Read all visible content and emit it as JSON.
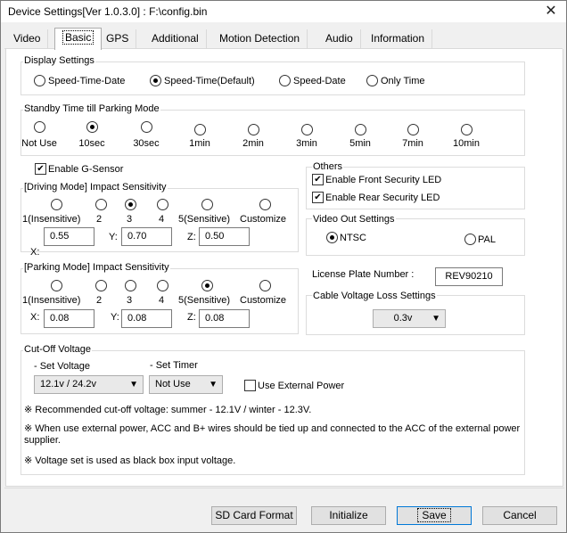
{
  "window": {
    "title": "Device Settings[Ver 1.0.3.0] : F:\\config.bin",
    "close": "✕"
  },
  "tabs": [
    "Video",
    "Basic",
    "GPS",
    "Additional",
    "Motion Detection",
    "Audio",
    "Information"
  ],
  "display": {
    "title": "Display Settings",
    "options": [
      "Speed-Time-Date",
      "Speed-Time(Default)",
      "Speed-Date",
      "Only Time"
    ],
    "selected": "Speed-Time(Default)"
  },
  "standby": {
    "title": "Standby Time till Parking Mode",
    "options": [
      "Not Use",
      "10sec",
      "30sec",
      "1min",
      "2min",
      "3min",
      "5min",
      "7min",
      "10min"
    ],
    "selected": "10sec"
  },
  "gsensor": {
    "label": "Enable G-Sensor",
    "checked": true
  },
  "driving": {
    "title": "[Driving Mode] Impact Sensitivity",
    "levels": [
      "1(Insensitive)",
      "2",
      "3",
      "4",
      "5(Sensitive)",
      "Customize"
    ],
    "selected": "3",
    "x_label": "X:",
    "x": "0.55",
    "y_label": "Y:",
    "y": "0.70",
    "z_label": "Z:",
    "z": "0.50"
  },
  "parking": {
    "title": "[Parking Mode] Impact Sensitivity",
    "levels": [
      "1(Insensitive)",
      "2",
      "3",
      "4",
      "5(Sensitive)",
      "Customize"
    ],
    "selected": "5(Sensitive)",
    "x_label": "X:",
    "x": "0.08",
    "y_label": "Y:",
    "y": "0.08",
    "z_label": "Z:",
    "z": "0.08"
  },
  "others": {
    "title": "Others",
    "front_led": "Enable Front Security LED",
    "front_checked": true,
    "rear_led": "Enable Rear Security LED",
    "rear_checked": true
  },
  "videoout": {
    "title": "Video Out Settings",
    "ntsc": "NTSC",
    "pal": "PAL",
    "selected": "NTSC"
  },
  "license": {
    "label": "License Plate Number :",
    "value": "REV90210"
  },
  "cable": {
    "title": "Cable Voltage Loss Settings",
    "value": "0.3v"
  },
  "cutoff": {
    "title": "Cut-Off Voltage",
    "set_voltage_label": "- Set Voltage",
    "set_voltage_value": "12.1v / 24.2v",
    "set_timer_label": "- Set Timer",
    "set_timer_value": "Not Use",
    "external_power": "Use External Power",
    "external_checked": false,
    "note1": "※ Recommended cut-off voltage: summer - 12.1V / winter - 12.3V.",
    "note2": "※ When use external power, ACC and B+ wires should be tied up and connected to the ACC of the external power supplier.",
    "note3": "※ Voltage set is used as black box input voltage."
  },
  "footer": {
    "sd_format": "SD Card Format",
    "initialize": "Initialize",
    "save": "Save",
    "cancel": "Cancel"
  }
}
